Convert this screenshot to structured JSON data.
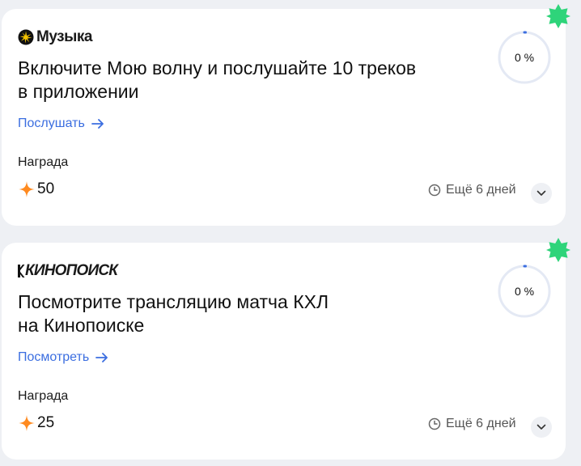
{
  "tasks": [
    {
      "service": "Музыка",
      "title_line1": "Включите Мою волну и послушайте 10 треков",
      "title_line2": "в приложении",
      "action_label": "Послушать",
      "reward_label": "Награда",
      "reward_value": "50",
      "progress_text": "0 %",
      "progress_fraction": 0,
      "deadline": "Ещё 6 дней"
    },
    {
      "service": "КИНОПОИСК",
      "title_line1": "Посмотрите трансляцию матча КХЛ",
      "title_line2": "на Кинопоиске",
      "action_label": "Посмотреть",
      "reward_label": "Награда",
      "reward_value": "25",
      "progress_text": "0 %",
      "progress_fraction": 0,
      "deadline": "Ещё 6 дней"
    }
  ],
  "colors": {
    "accent": "#3b6ee0",
    "badge": "#2ed47a",
    "reward_star": "#ff8a1f",
    "progress_track": "#e4e9f4",
    "progress_fill": "#3b6ee0"
  },
  "icons": [
    "music-logo-icon",
    "kinopoisk-logo-icon",
    "arrow-right-icon",
    "reward-star-icon",
    "clock-icon",
    "chevron-down-icon",
    "star-badge-icon"
  ]
}
